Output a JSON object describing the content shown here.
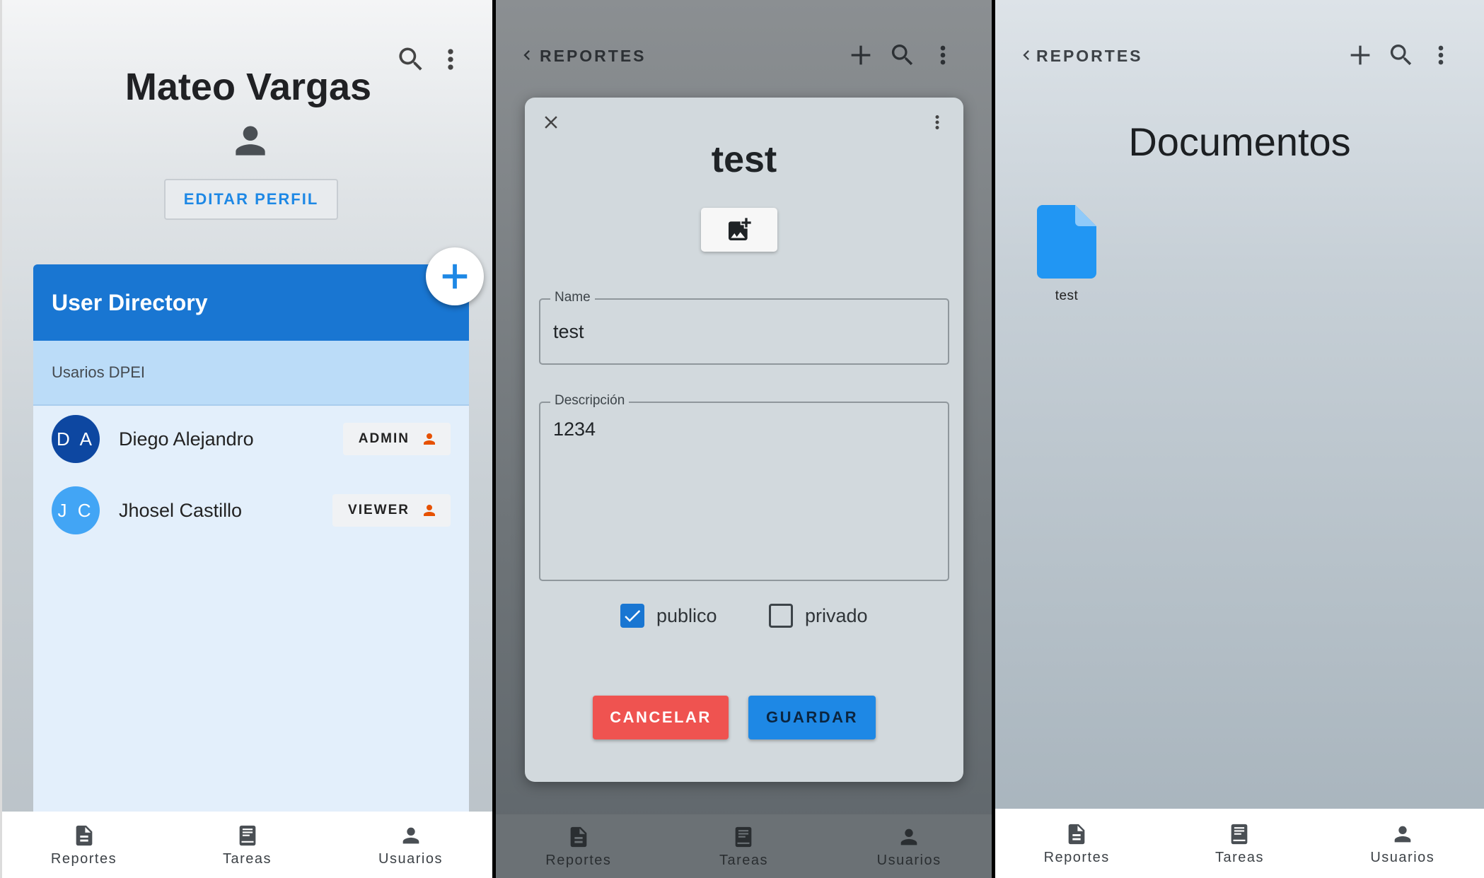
{
  "profile": {
    "name": "Mateo Vargas",
    "edit_label": "EDITAR PERFIL",
    "directory": {
      "title": "User Directory",
      "subtitle": "Usarios DPEI",
      "users": [
        {
          "initials": "D A",
          "name": "Diego Alejandro",
          "role": "ADMIN",
          "avatar_color": "#0d47a1"
        },
        {
          "initials": "J C",
          "name": "Jhosel Castillo",
          "role": "VIEWER",
          "avatar_color": "#42a5f5"
        }
      ]
    }
  },
  "report_dialog": {
    "back_label": "REPORTES",
    "title": "test",
    "name_label": "Name",
    "name_value": "test",
    "description_label": "Descripción",
    "description_value": "1234",
    "option_public": "publico",
    "option_private": "privado",
    "public_checked": true,
    "private_checked": false,
    "cancel_label": "CANCELAR",
    "save_label": "GUARDAR"
  },
  "documents": {
    "back_label": "REPORTES",
    "title": "Documentos",
    "items": [
      {
        "name": "test"
      }
    ]
  },
  "nav": {
    "items": [
      {
        "label": "Reportes"
      },
      {
        "label": "Tareas"
      },
      {
        "label": "Usuarios"
      }
    ]
  },
  "colors": {
    "primary": "#1976d2",
    "accent_blue": "#1e88e5",
    "cancel": "#ef5350",
    "role_icon": "#e65100",
    "file_icon": "#2196f3"
  }
}
